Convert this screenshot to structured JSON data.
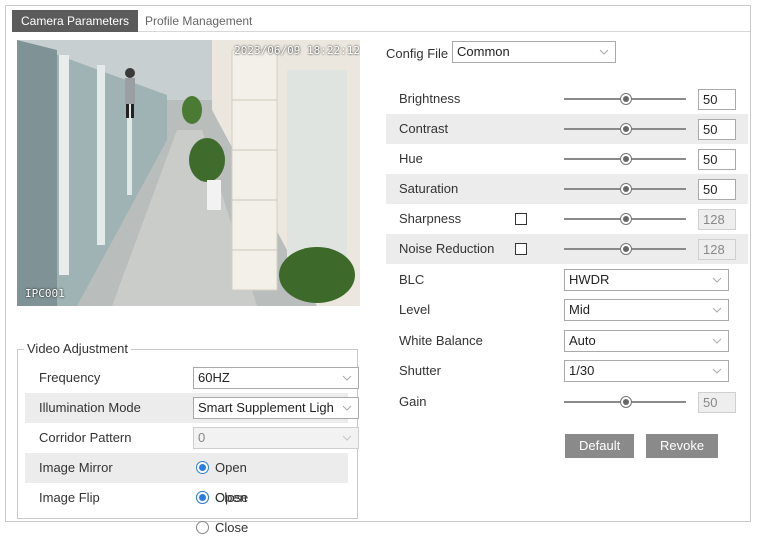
{
  "tabs": {
    "camera_parameters": "Camera Parameters",
    "profile_management": "Profile Management"
  },
  "preview": {
    "timestamp": "2023/06/09 18:22:12",
    "camera_name": "IPC001"
  },
  "video_adjustment": {
    "legend": "Video Adjustment",
    "frequency": {
      "label": "Frequency",
      "value": "60HZ"
    },
    "illumination_mode": {
      "label": "Illumination Mode",
      "value": "Smart Supplement Ligh"
    },
    "corridor_pattern": {
      "label": "Corridor Pattern",
      "value": "0"
    },
    "image_mirror": {
      "label": "Image Mirror",
      "open": "Open",
      "close": "Close",
      "selected": "Open"
    },
    "image_flip": {
      "label": "Image Flip",
      "open": "Open",
      "close": "Close",
      "selected": "Open"
    }
  },
  "config": {
    "label": "Config File",
    "value": "Common"
  },
  "params": {
    "brightness": {
      "label": "Brightness",
      "value": "50"
    },
    "contrast": {
      "label": "Contrast",
      "value": "50"
    },
    "hue": {
      "label": "Hue",
      "value": "50"
    },
    "saturation": {
      "label": "Saturation",
      "value": "50"
    },
    "sharpness": {
      "label": "Sharpness",
      "value": "128"
    },
    "noise_reduction": {
      "label": "Noise Reduction",
      "value": "128"
    },
    "blc": {
      "label": "BLC",
      "value": "HWDR"
    },
    "level": {
      "label": "Level",
      "value": "Mid"
    },
    "white_balance": {
      "label": "White Balance",
      "value": "Auto"
    },
    "shutter": {
      "label": "Shutter",
      "value": "1/30"
    },
    "gain": {
      "label": "Gain",
      "value": "50"
    }
  },
  "buttons": {
    "default": "Default",
    "revoke": "Revoke"
  },
  "colors": {
    "active_tab": "#5b5b5b",
    "row_shade": "#ececec",
    "button": "#8a8a8a",
    "radio_accent": "#2b7de0"
  }
}
